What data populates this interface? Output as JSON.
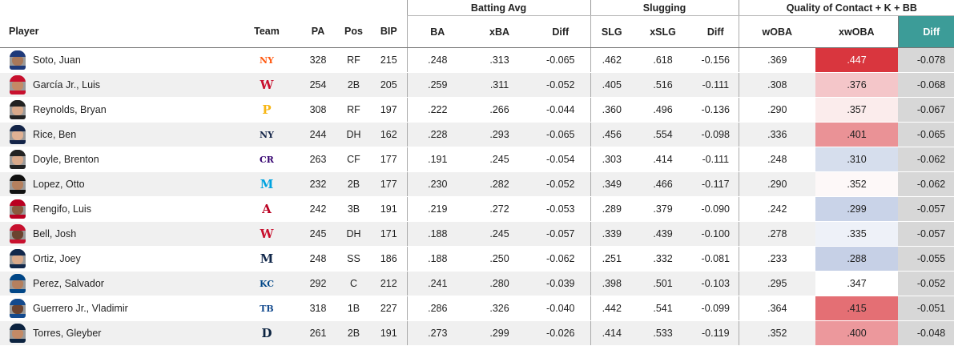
{
  "groups": {
    "batting_avg": "Batting Avg",
    "slugging": "Slugging",
    "quality": "Quality of Contact + K + BB"
  },
  "headers": {
    "player": "Player",
    "team": "Team",
    "pa": "PA",
    "pos": "Pos",
    "bip": "BIP",
    "ba": "BA",
    "xba": "xBA",
    "ba_diff": "Diff",
    "slg": "SLG",
    "xslg": "xSLG",
    "slg_diff": "Diff",
    "woba": "wOBA",
    "xwoba": "xwOBA",
    "woba_diff": "Diff"
  },
  "colors": {
    "sorted_header": "#3c9c98",
    "diff_column": "#d7d7d7"
  },
  "rows": [
    {
      "player": "Soto, Juan",
      "team_icon": "mets-logo",
      "team_mark": "NY",
      "team_color": "#ff5910",
      "cap": "#1f3a7a",
      "skin": "#a9785a",
      "pa": "328",
      "pos": "RF",
      "bip": "215",
      "ba": ".248",
      "xba": ".313",
      "ba_diff": "-0.065",
      "slg": ".462",
      "xslg": ".618",
      "slg_diff": "-0.156",
      "woba": ".369",
      "xwoba": ".447",
      "xwoba_color": "#d9363e",
      "xwoba_text": "#ffffff",
      "woba_diff": "-0.078"
    },
    {
      "player": "García Jr., Luis",
      "team_icon": "nationals-logo",
      "team_mark": "W",
      "team_color": "#c8102e",
      "cap": "#c8102e",
      "skin": "#c48a66",
      "pa": "254",
      "pos": "2B",
      "bip": "205",
      "ba": ".259",
      "xba": ".311",
      "ba_diff": "-0.052",
      "slg": ".405",
      "xslg": ".516",
      "slg_diff": "-0.111",
      "woba": ".308",
      "xwoba": ".376",
      "xwoba_color": "#f4c6c9",
      "xwoba_text": "#222222",
      "woba_diff": "-0.068"
    },
    {
      "player": "Reynolds, Bryan",
      "team_icon": "pirates-logo",
      "team_mark": "P",
      "team_color": "#f7b614",
      "cap": "#222222",
      "skin": "#d9a98a",
      "pa": "308",
      "pos": "RF",
      "bip": "197",
      "ba": ".222",
      "xba": ".266",
      "ba_diff": "-0.044",
      "slg": ".360",
      "xslg": ".496",
      "slg_diff": "-0.136",
      "woba": ".290",
      "xwoba": ".357",
      "xwoba_color": "#fbecec",
      "xwoba_text": "#222222",
      "woba_diff": "-0.067"
    },
    {
      "player": "Rice, Ben",
      "team_icon": "yankees-logo",
      "team_mark": "NY",
      "team_color": "#132448",
      "cap": "#132448",
      "skin": "#e0b194",
      "pa": "244",
      "pos": "DH",
      "bip": "162",
      "ba": ".228",
      "xba": ".293",
      "ba_diff": "-0.065",
      "slg": ".456",
      "xslg": ".554",
      "slg_diff": "-0.098",
      "woba": ".336",
      "xwoba": ".401",
      "xwoba_color": "#ea9296",
      "xwoba_text": "#222222",
      "woba_diff": "-0.065"
    },
    {
      "player": "Doyle, Brenton",
      "team_icon": "rockies-logo",
      "team_mark": "CR",
      "team_color": "#33006f",
      "cap": "#222222",
      "skin": "#d9a98a",
      "pa": "263",
      "pos": "CF",
      "bip": "177",
      "ba": ".191",
      "xba": ".245",
      "ba_diff": "-0.054",
      "slg": ".303",
      "xslg": ".414",
      "slg_diff": "-0.111",
      "woba": ".248",
      "xwoba": ".310",
      "xwoba_color": "#d6deed",
      "xwoba_text": "#222222",
      "woba_diff": "-0.062"
    },
    {
      "player": "Lopez, Otto",
      "team_icon": "marlins-logo",
      "team_mark": "M",
      "team_color": "#00a3e0",
      "cap": "#111111",
      "skin": "#b5805e",
      "pa": "232",
      "pos": "2B",
      "bip": "177",
      "ba": ".230",
      "xba": ".282",
      "ba_diff": "-0.052",
      "slg": ".349",
      "xslg": ".466",
      "slg_diff": "-0.117",
      "woba": ".290",
      "xwoba": ".352",
      "xwoba_color": "#fdf8f8",
      "xwoba_text": "#222222",
      "woba_diff": "-0.062"
    },
    {
      "player": "Rengifo, Luis",
      "team_icon": "angels-logo",
      "team_mark": "A",
      "team_color": "#ba0021",
      "cap": "#ba0021",
      "skin": "#8a5a3e",
      "pa": "242",
      "pos": "3B",
      "bip": "191",
      "ba": ".219",
      "xba": ".272",
      "ba_diff": "-0.053",
      "slg": ".289",
      "xslg": ".379",
      "slg_diff": "-0.090",
      "woba": ".242",
      "xwoba": ".299",
      "xwoba_color": "#c9d3e8",
      "xwoba_text": "#222222",
      "woba_diff": "-0.057"
    },
    {
      "player": "Bell, Josh",
      "team_icon": "nationals-logo",
      "team_mark": "W",
      "team_color": "#c8102e",
      "cap": "#c8102e",
      "skin": "#6b4330",
      "pa": "245",
      "pos": "DH",
      "bip": "171",
      "ba": ".188",
      "xba": ".245",
      "ba_diff": "-0.057",
      "slg": ".339",
      "xslg": ".439",
      "slg_diff": "-0.100",
      "woba": ".278",
      "xwoba": ".335",
      "xwoba_color": "#eef1f8",
      "xwoba_text": "#222222",
      "woba_diff": "-0.057"
    },
    {
      "player": "Ortiz, Joey",
      "team_icon": "brewers-logo",
      "team_mark": "M",
      "team_color": "#12284b",
      "cap": "#12284b",
      "skin": "#d9a98a",
      "pa": "248",
      "pos": "SS",
      "bip": "186",
      "ba": ".188",
      "xba": ".250",
      "ba_diff": "-0.062",
      "slg": ".251",
      "xslg": ".332",
      "slg_diff": "-0.081",
      "woba": ".233",
      "xwoba": ".288",
      "xwoba_color": "#c6d0e6",
      "xwoba_text": "#222222",
      "woba_diff": "-0.055"
    },
    {
      "player": "Perez, Salvador",
      "team_icon": "royals-logo",
      "team_mark": "KC",
      "team_color": "#004687",
      "cap": "#004687",
      "skin": "#b5805e",
      "pa": "292",
      "pos": "C",
      "bip": "212",
      "ba": ".241",
      "xba": ".280",
      "ba_diff": "-0.039",
      "slg": ".398",
      "xslg": ".501",
      "slg_diff": "-0.103",
      "woba": ".295",
      "xwoba": ".347",
      "xwoba_color": "#ffffff",
      "xwoba_text": "#222222",
      "woba_diff": "-0.052"
    },
    {
      "player": "Guerrero Jr., Vladimir",
      "team_icon": "blue-jays-logo",
      "team_mark": "TB",
      "team_color": "#134a8e",
      "cap": "#134a8e",
      "skin": "#6b4330",
      "pa": "318",
      "pos": "1B",
      "bip": "227",
      "ba": ".286",
      "xba": ".326",
      "ba_diff": "-0.040",
      "slg": ".442",
      "xslg": ".541",
      "slg_diff": "-0.099",
      "woba": ".364",
      "xwoba": ".415",
      "xwoba_color": "#e46f74",
      "xwoba_text": "#222222",
      "woba_diff": "-0.051"
    },
    {
      "player": "Torres, Gleyber",
      "team_icon": "tigers-logo",
      "team_mark": "D",
      "team_color": "#0c2340",
      "cap": "#0c2340",
      "skin": "#c48a66",
      "pa": "261",
      "pos": "2B",
      "bip": "191",
      "ba": ".273",
      "xba": ".299",
      "ba_diff": "-0.026",
      "slg": ".414",
      "xslg": ".533",
      "slg_diff": "-0.119",
      "woba": ".352",
      "xwoba": ".400",
      "xwoba_color": "#ec989c",
      "xwoba_text": "#222222",
      "woba_diff": "-0.048"
    }
  ]
}
